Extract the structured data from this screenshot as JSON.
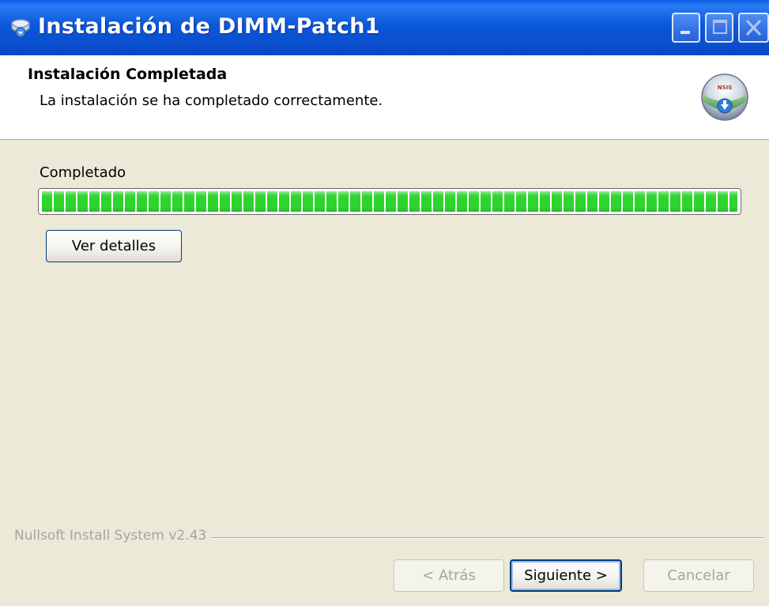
{
  "window": {
    "title": "Instalación de DIMM-Patch1",
    "icon": "installer-icon",
    "controls": {
      "minimize": "minimize-icon",
      "maximize": "maximize-icon",
      "close": "close-icon"
    }
  },
  "header": {
    "title": "Instalación Completada",
    "subtitle": "La instalación se ha completado correctamente.",
    "logo_text": "NSIS",
    "logo_icon": "nsis-installer-icon"
  },
  "content": {
    "progress_label": "Completado",
    "progress_value": 1.0,
    "details_button_label": "Ver detalles"
  },
  "footer": {
    "branding": "Nullsoft Install System v2.43",
    "back_label": "< Atrás",
    "next_label": "Siguiente >",
    "cancel_label": "Cancelar"
  },
  "colors": {
    "titlebar": "#0a58d8",
    "progress_fill": "#2ed52e",
    "background": "#ece9d8",
    "disabled_text": "#a7a4a0"
  }
}
